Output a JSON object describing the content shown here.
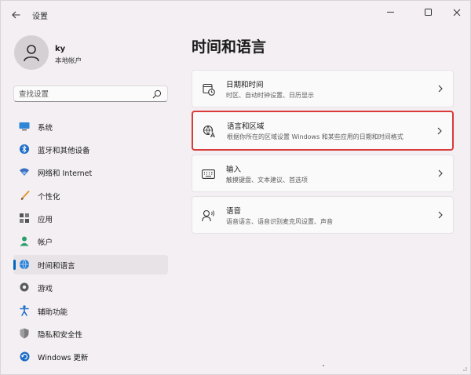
{
  "window": {
    "title": "设置"
  },
  "account": {
    "name": "ky",
    "type": "本地帐户"
  },
  "search": {
    "placeholder": "查找设置"
  },
  "sidebar": {
    "selected": "时间和语言",
    "items": [
      {
        "label": "系统",
        "icon": "monitor-icon"
      },
      {
        "label": "蓝牙和其他设备",
        "icon": "bluetooth-icon"
      },
      {
        "label": "网络和 Internet",
        "icon": "wifi-icon"
      },
      {
        "label": "个性化",
        "icon": "brush-icon"
      },
      {
        "label": "应用",
        "icon": "apps-icon"
      },
      {
        "label": "帐户",
        "icon": "account-icon"
      },
      {
        "label": "时间和语言",
        "icon": "globe-clock-icon"
      },
      {
        "label": "游戏",
        "icon": "game-icon"
      },
      {
        "label": "辅助功能",
        "icon": "accessibility-icon"
      },
      {
        "label": "隐私和安全性",
        "icon": "shield-icon"
      },
      {
        "label": "Windows 更新",
        "icon": "update-icon"
      }
    ]
  },
  "main": {
    "title": "时间和语言",
    "cards": [
      {
        "title": "日期和时间",
        "desc": "时区、自动时钟设置、日历显示",
        "icon": "calendar-clock-icon"
      },
      {
        "title": "语言和区域",
        "desc": "根据你所在的区域设置 Windows 和某些应用的日期和时间格式",
        "icon": "language-icon"
      },
      {
        "title": "输入",
        "desc": "触摸键盘、文本建议、首选项",
        "icon": "keyboard-icon"
      },
      {
        "title": "语音",
        "desc": "语音语言、语音识别麦克风设置、声音",
        "icon": "speech-icon"
      }
    ]
  },
  "colors": {
    "accent": "#0067c0",
    "highlight_border": "#d93a3a"
  }
}
